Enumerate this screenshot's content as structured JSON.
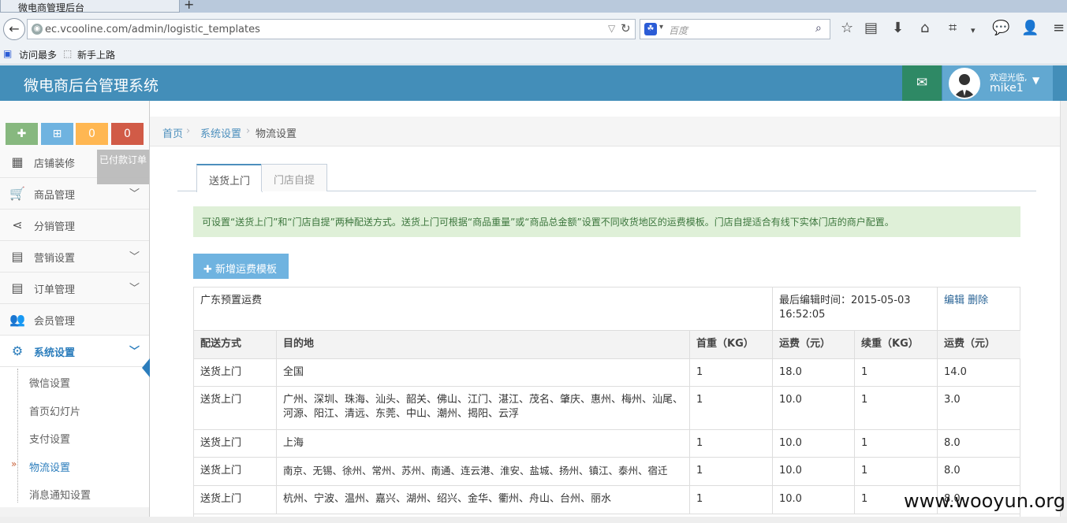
{
  "browser": {
    "tab_title": "微电商管理后台",
    "url": "ec.vcooline.com/admin/logistic_templates",
    "search_placeholder": "百度",
    "bookmarks": [
      "访问最多",
      "新手上路"
    ]
  },
  "header": {
    "brand": "微电商后台管理系统",
    "welcome": "欢迎光临,",
    "username": "mike1",
    "colors": {
      "header": "#438eb9",
      "mail": "#2e8965",
      "user": "#62a8d1"
    }
  },
  "shortcuts": {
    "btn3": "0",
    "btn4": "0",
    "tooltip": "已付款订单"
  },
  "sidebar": {
    "items": [
      {
        "label": "店铺装修"
      },
      {
        "label": "商品管理"
      },
      {
        "label": "分销管理"
      },
      {
        "label": "营销设置"
      },
      {
        "label": "订单管理"
      },
      {
        "label": "会员管理"
      },
      {
        "label": "系统设置"
      }
    ],
    "sub_items": [
      {
        "label": "微信设置"
      },
      {
        "label": "首页幻灯片"
      },
      {
        "label": "支付设置"
      },
      {
        "label": "物流设置"
      },
      {
        "label": "消息通知设置"
      }
    ]
  },
  "breadcrumb": {
    "home": "首页",
    "section": "系统设置",
    "current": "物流设置"
  },
  "tabs": {
    "delivery": "送货上门",
    "pickup": "门店自提"
  },
  "notice": "可设置“送货上门”和“门店自提”两种配送方式。送货上门可根据“商品重量”或“商品总金额”设置不同收货地区的运费模板。门店自提适合有线下实体门店的商户配置。",
  "add_button": "新增运费模板",
  "template": {
    "name": "广东预置运费",
    "last_edit_label": "最后编辑时间：2015-05-03",
    "last_edit_time": "16:52:05",
    "edit": "编辑",
    "delete": "删除",
    "columns": [
      "配送方式",
      "目的地",
      "首重（KG）",
      "运费（元）",
      "续重（KG）",
      "运费（元）"
    ],
    "rows": [
      {
        "method": "送货上门",
        "dest": "全国",
        "first": "1",
        "fee": "18.0",
        "extra": "1",
        "extra_fee": "14.0"
      },
      {
        "method": "送货上门",
        "dest": "广州、深圳、珠海、汕头、韶关、佛山、江门、湛江、茂名、肇庆、惠州、梅州、汕尾、河源、阳江、清远、东莞、中山、潮州、揭阳、云浮",
        "first": "1",
        "fee": "10.0",
        "extra": "1",
        "extra_fee": "3.0"
      },
      {
        "method": "送货上门",
        "dest": "上海",
        "first": "1",
        "fee": "10.0",
        "extra": "1",
        "extra_fee": "8.0"
      },
      {
        "method": "送货上门",
        "dest": "南京、无锡、徐州、常州、苏州、南通、连云港、淮安、盐城、扬州、镇江、泰州、宿迁",
        "first": "1",
        "fee": "10.0",
        "extra": "1",
        "extra_fee": "8.0"
      },
      {
        "method": "送货上门",
        "dest": "杭州、宁波、温州、嘉兴、湖州、绍兴、金华、衢州、舟山、台州、丽水",
        "first": "1",
        "fee": "10.0",
        "extra": "1",
        "extra_fee": "8.0"
      }
    ]
  },
  "watermark": "www.wooyun.org"
}
